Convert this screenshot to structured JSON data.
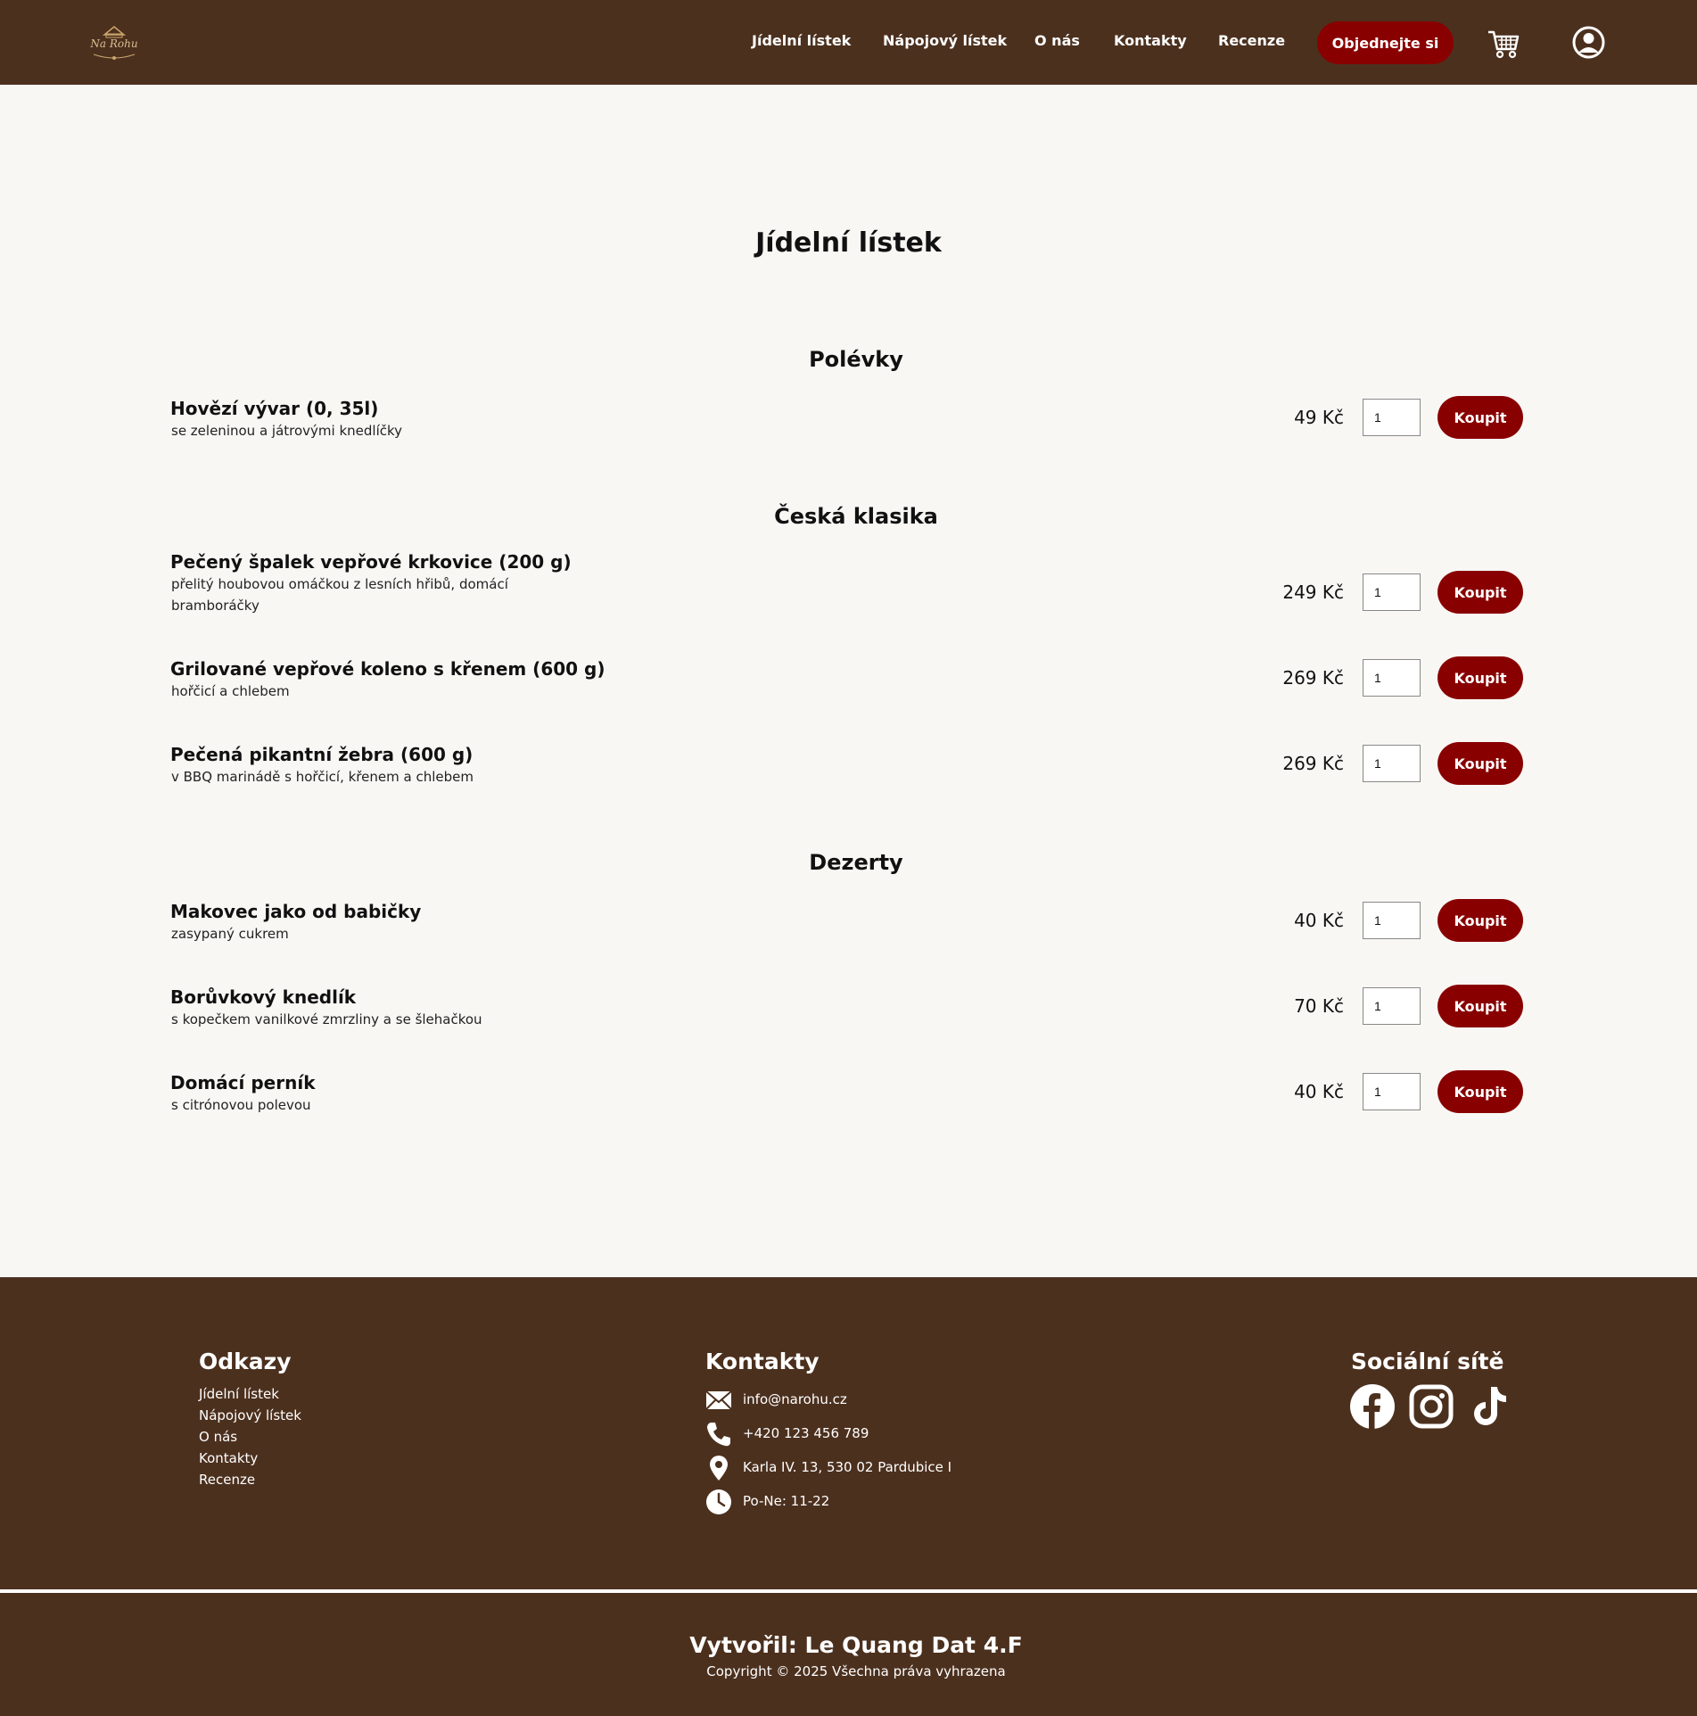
{
  "header": {
    "logo_text": "Na Rohu",
    "nav": [
      "Jídelní lístek",
      "Nápojový lístek",
      "O nás",
      "Kontakty",
      "Recenze"
    ],
    "order_button": "Objednejte si",
    "cart_icon": "cart-icon",
    "user_icon": "user-icon"
  },
  "main": {
    "title": "Jídelní lístek",
    "buy_label": "Koupit",
    "sections": [
      {
        "title": "Polévky",
        "items": [
          {
            "name": "Hovězí vývar (0, 35l)",
            "desc": "se zeleninou a játrovými knedlíčky",
            "price": "49 Kč",
            "qty": "1"
          }
        ]
      },
      {
        "title": "Česká klasika",
        "items": [
          {
            "name": "Pečený špalek vepřové krkovice (200 g)",
            "desc": "přelitý houbovou omáčkou z lesních hřibů, domácí bramboráčky",
            "price": "249 Kč",
            "qty": "1"
          },
          {
            "name": "Grilované vepřové koleno s křenem (600 g)",
            "desc": "hořčicí a chlebem",
            "price": "269 Kč",
            "qty": "1"
          },
          {
            "name": "Pečená pikantní žebra (600 g)",
            "desc": "v BBQ marinádě s hořčicí, křenem a chlebem",
            "price": "269 Kč",
            "qty": "1"
          }
        ]
      },
      {
        "title": "Dezerty",
        "items": [
          {
            "name": "Makovec jako od babičky",
            "desc": "zasypaný cukrem",
            "price": "40 Kč",
            "qty": "1"
          },
          {
            "name": "Borůvkový knedlík",
            "desc": "s kopečkem vanilkové zmrzliny a se šlehačkou",
            "price": "70 Kč",
            "qty": "1"
          },
          {
            "name": "Domácí perník",
            "desc": "s citrónovou polevou",
            "price": "40 Kč",
            "qty": "1"
          }
        ]
      }
    ]
  },
  "footer": {
    "links_heading": "Odkazy",
    "links": [
      "Jídelní lístek",
      "Nápojový lístek",
      "O nás",
      "Kontakty",
      "Recenze"
    ],
    "contacts_heading": "Kontakty",
    "contacts": [
      {
        "icon": "mail-icon",
        "text": "info@narohu.cz"
      },
      {
        "icon": "phone-icon",
        "text": "+420 123 456 789"
      },
      {
        "icon": "location-icon",
        "text": "Karla IV. 13, 530 02 Pardubice I"
      },
      {
        "icon": "clock-icon",
        "text": "Po-Ne: 11-22"
      }
    ],
    "social_heading": "Sociální sítě",
    "social_icons": [
      "facebook-icon",
      "instagram-icon",
      "tiktok-icon"
    ],
    "credit": "Vytvořil: Le Quang Dat 4.F",
    "copyright": "Copyright © 2025 Všechna práva vyhrazena"
  },
  "colors": {
    "header_bg": "#4c301e",
    "accent": "#890000",
    "page_bg": "#f8f7f4"
  }
}
